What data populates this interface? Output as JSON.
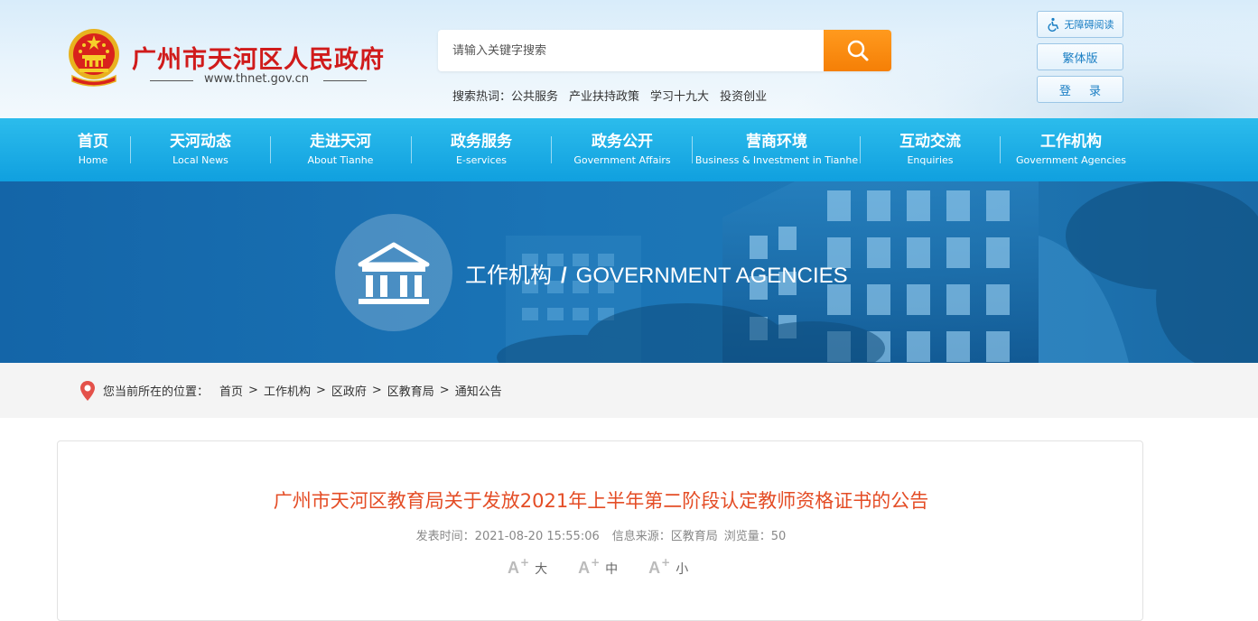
{
  "header": {
    "site_title": "广州市天河区人民政府",
    "site_url": "www.thnet.gov.cn",
    "search": {
      "placeholder": "请输入关键字搜索"
    },
    "hot_label": "搜索热词：",
    "hot_words": [
      "公共服务",
      "产业扶持政策",
      "学习十九大",
      "投资创业"
    ],
    "accessibility_label": "无障碍阅读",
    "traditional_label": "繁体版",
    "login_label": "登 录"
  },
  "nav": {
    "items": [
      {
        "cn": "首页",
        "en": "Home"
      },
      {
        "cn": "天河动态",
        "en": "Local News"
      },
      {
        "cn": "走进天河",
        "en": "About Tianhe"
      },
      {
        "cn": "政务服务",
        "en": "E-services"
      },
      {
        "cn": "政务公开",
        "en": "Government Affairs"
      },
      {
        "cn": "营商环境",
        "en": "Business & Investment in Tianhe"
      },
      {
        "cn": "互动交流",
        "en": "Enquiries"
      },
      {
        "cn": "工作机构",
        "en": "Government Agencies"
      }
    ]
  },
  "banner": {
    "title_cn": "工作机构",
    "slash": "/",
    "title_en": "GOVERNMENT AGENCIES"
  },
  "breadcrumb": {
    "label": "您当前所在的位置：",
    "items": [
      "首页",
      "工作机构",
      "区政府",
      "区教育局",
      "通知公告"
    ],
    "separator": ">"
  },
  "article": {
    "title": "广州市天河区教育局关于发放2021年上半年第二阶段认定教师资格证书的公告",
    "publish_time": "发表时间：2021-08-20 15:55:06",
    "source": "信息来源：区教育局",
    "views": "浏览量：50",
    "font_sizes": [
      {
        "letter": "A",
        "plus": "+",
        "label": "大"
      },
      {
        "letter": "A",
        "plus": "+",
        "label": "中"
      },
      {
        "letter": "A",
        "plus": "+",
        "label": "小"
      }
    ]
  },
  "colors": {
    "brand_red": "#d01b1b",
    "nav_blue": "#10a0df",
    "search_orange": "#f57f06",
    "title_orange": "#e44d26"
  }
}
